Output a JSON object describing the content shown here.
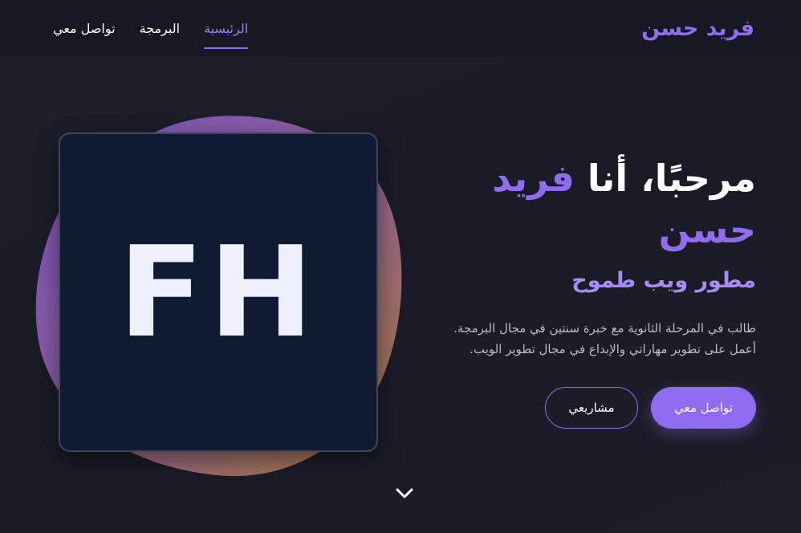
{
  "navbar": {
    "brand": "فريد حسن",
    "links": [
      {
        "label": "الرئيسية",
        "active": true
      },
      {
        "label": "البرمجة",
        "active": false
      },
      {
        "label": "تواصل معي",
        "active": false
      }
    ]
  },
  "hero": {
    "title_prefix": "مرحبًا، أنا",
    "title_name": "فريد حسن",
    "subtitle": "مطور ويب طموح",
    "description_line1": "طالب في المرحلة الثانوية مع خبرة سنتين في مجال البرمجة.",
    "description_line2": "أعمل على تطوير مهاراتي والإبداع في مجال تطوير الويب.",
    "primary_button": "تواصل معي",
    "secondary_button": "مشاريعي"
  },
  "avatar": {
    "initials": "FH"
  },
  "icons": {
    "scroll": "chevron-down-icon"
  },
  "colors": {
    "accent": "#8f6cf0",
    "background": "#1b1c27",
    "navbar": "#171821",
    "card": "#111a33"
  }
}
